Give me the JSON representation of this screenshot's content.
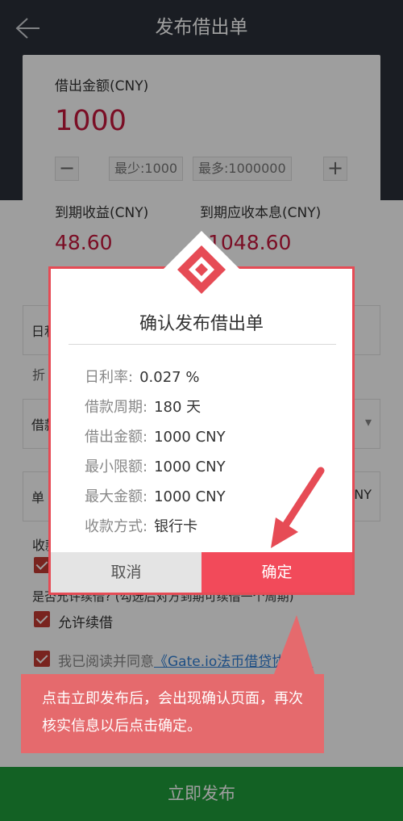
{
  "header": {
    "title": "发布借出单"
  },
  "form": {
    "amount_label": "借出金额(CNY)",
    "amount_value": "1000",
    "min_label": "最少:1000",
    "max_label": "最多:1000000",
    "expected_income_label": "到期收益(CNY)",
    "expected_income_value": "48.60",
    "expected_total_label": "到期应收本息(CNY)",
    "expected_total_value": "1048.60",
    "daily_rate_label": "日利率",
    "fold_hint": "折",
    "period_label": "借款",
    "unit_label": "单",
    "unit_suffix": "NY",
    "receive_method_label": "收款",
    "renew_question": "是否允许续借? (勾选后对方到期可续借一个周期)",
    "allow_renew_label": "允许续借",
    "agree_text": "我已阅读并同意",
    "agreement_link": "《Gate.io法币借贷协议》",
    "publish_button": "立即发布"
  },
  "dialog": {
    "title": "确认发布借出单",
    "rows": [
      {
        "label": "日利率:",
        "value": "0.027  %"
      },
      {
        "label": "借款周期:",
        "value": "180  天"
      },
      {
        "label": "借出金额:",
        "value": "1000  CNY"
      },
      {
        "label": "最小限额:",
        "value": "1000  CNY"
      },
      {
        "label": "最大金额:",
        "value": "1000  CNY"
      },
      {
        "label": "收款方式:",
        "value": "银行卡"
      }
    ],
    "cancel_label": "取消",
    "confirm_label": "确定"
  },
  "annotation": {
    "text": "点击立即发布后，会出现确认页面，再次核实信息以后点击确定。"
  },
  "colors": {
    "header_bg": "#2b3039",
    "amount_red": "#c6183d",
    "confirm_red": "#f24a5a",
    "callout_bg": "#e56a6d",
    "publish_green": "#1f9d3a",
    "checkbox_red": "#c43a32"
  },
  "icons": [
    "back-arrow-icon",
    "minus-icon",
    "plus-icon",
    "dropdown-caret-icon",
    "checkbox-icon",
    "gate-logo-icon",
    "pointer-arrow-icon"
  ]
}
